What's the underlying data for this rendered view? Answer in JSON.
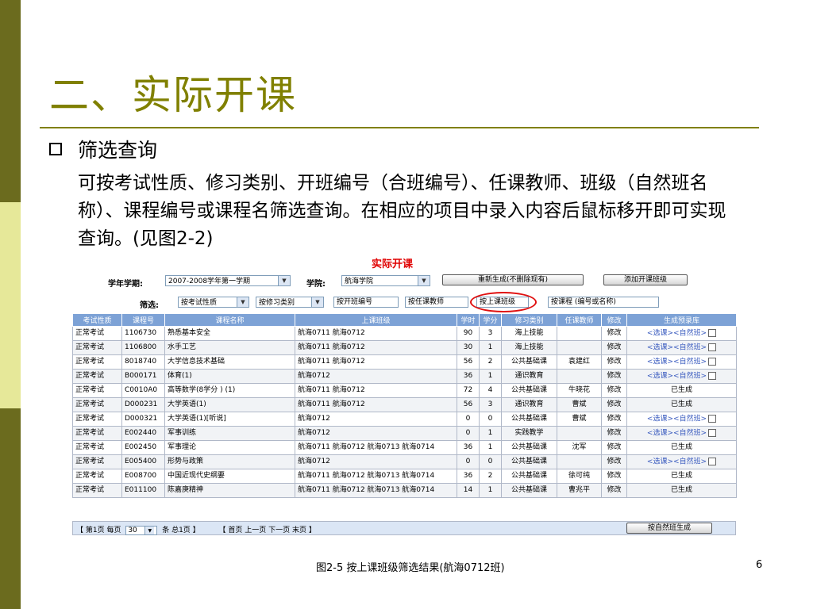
{
  "slide": {
    "title": "二、实际开课",
    "bullet": "筛选查询",
    "paragraph": "可按考试性质、修习类别、开班编号（合班编号）、任课教师、班级（自然班名称）、课程编号或课程名筛选查询。在相应的项目中录入内容后鼠标移开即可实现查询。(见图2-2)",
    "caption": "图2-5   按上课班级筛选结果(航海0712班)",
    "page_number": "6"
  },
  "app": {
    "title": "实际开课",
    "term_label": "学年学期:",
    "term_value": "2007-2008学年第一学期",
    "college_label": "学院:",
    "college_value": "航海学院",
    "regenerate_button": "重新生成(不删除现有)",
    "add_class_button": "添加开课班级",
    "filter_label": "筛选:",
    "filters": {
      "exam_type": "按考试性质",
      "study_type": "按修习类别",
      "class_code": "按开班编号",
      "teacher": "按任课教师",
      "class_group": "按上课班级",
      "course": "按课程 (编号或名称)"
    }
  },
  "table": {
    "headers": [
      "考试性质",
      "课程号",
      "课程名称",
      "上课班级",
      "学时",
      "学分",
      "修习类别",
      "任课教师",
      "修改",
      "生成预录库"
    ],
    "rows": [
      {
        "exam": "正常考试",
        "code": "1106730",
        "name": "熟悉基本安全",
        "cls": "航海0711 航海0712",
        "hours": "90",
        "credit": "3",
        "type": "海上技能",
        "teacher": "",
        "edit": "修改",
        "gen": "<选课><自然班>"
      },
      {
        "exam": "正常考试",
        "code": "1106800",
        "name": "水手工艺",
        "cls": "航海0711 航海0712",
        "hours": "30",
        "credit": "1",
        "type": "海上技能",
        "teacher": "",
        "edit": "修改",
        "gen": "<选课><自然班>"
      },
      {
        "exam": "正常考试",
        "code": "8018740",
        "name": "大学信息技术基础",
        "cls": "航海0711 航海0712",
        "hours": "56",
        "credit": "2",
        "type": "公共基础课",
        "teacher": "袁建红",
        "edit": "修改",
        "gen": "<选课><自然班>"
      },
      {
        "exam": "正常考试",
        "code": "B000171",
        "name": "体育(1)",
        "cls": "航海0712",
        "hours": "36",
        "credit": "1",
        "type": "通识教育",
        "teacher": "",
        "edit": "修改",
        "gen": "<选课><自然班>"
      },
      {
        "exam": "正常考试",
        "code": "C0010A0",
        "name": "高等数学(8学分 ) (1)",
        "cls": "航海0711 航海0712",
        "hours": "72",
        "credit": "4",
        "type": "公共基础课",
        "teacher": "牛晓花",
        "edit": "修改",
        "gen": "已生成"
      },
      {
        "exam": "正常考试",
        "code": "D000231",
        "name": "大学英语(1)",
        "cls": "航海0711 航海0712",
        "hours": "56",
        "credit": "3",
        "type": "通识教育",
        "teacher": "曹斌",
        "edit": "修改",
        "gen": "已生成"
      },
      {
        "exam": "正常考试",
        "code": "D000321",
        "name": "大学英语(1)[听说]",
        "cls": "航海0712",
        "hours": "0",
        "credit": "0",
        "type": "公共基础课",
        "teacher": "曹斌",
        "edit": "修改",
        "gen": "<选课><自然班>"
      },
      {
        "exam": "正常考试",
        "code": "E002440",
        "name": "军事训练",
        "cls": "航海0712",
        "hours": "0",
        "credit": "1",
        "type": "实践教学",
        "teacher": "",
        "edit": "修改",
        "gen": "<选课><自然班>"
      },
      {
        "exam": "正常考试",
        "code": "E002450",
        "name": "军事理论",
        "cls": "航海0711 航海0712 航海0713 航海0714",
        "hours": "36",
        "credit": "1",
        "type": "公共基础课",
        "teacher": "沈军",
        "edit": "修改",
        "gen": "已生成"
      },
      {
        "exam": "正常考试",
        "code": "E005400",
        "name": "形势与政策",
        "cls": "航海0712",
        "hours": "0",
        "credit": "0",
        "type": "公共基础课",
        "teacher": "",
        "edit": "修改",
        "gen": "<选课><自然班>"
      },
      {
        "exam": "正常考试",
        "code": "E008700",
        "name": "中国近现代史纲要",
        "cls": "航海0711 航海0712 航海0713 航海0714",
        "hours": "36",
        "credit": "2",
        "type": "公共基础课",
        "teacher": "徐可纯",
        "edit": "修改",
        "gen": "已生成"
      },
      {
        "exam": "正常考试",
        "code": "E011100",
        "name": "陈嘉庚精神",
        "cls": "航海0711 航海0712 航海0713 航海0714",
        "hours": "14",
        "credit": "1",
        "type": "公共基础课",
        "teacher": "曹兆平",
        "edit": "修改",
        "gen": "已生成"
      }
    ]
  },
  "pager": {
    "first_page": "【 第1页 每页",
    "page_size": "30",
    "total": "条 总1页 】",
    "nav": "【 首页 上一页 下一页 末页 】",
    "generate_button": "按自然班生成"
  }
}
